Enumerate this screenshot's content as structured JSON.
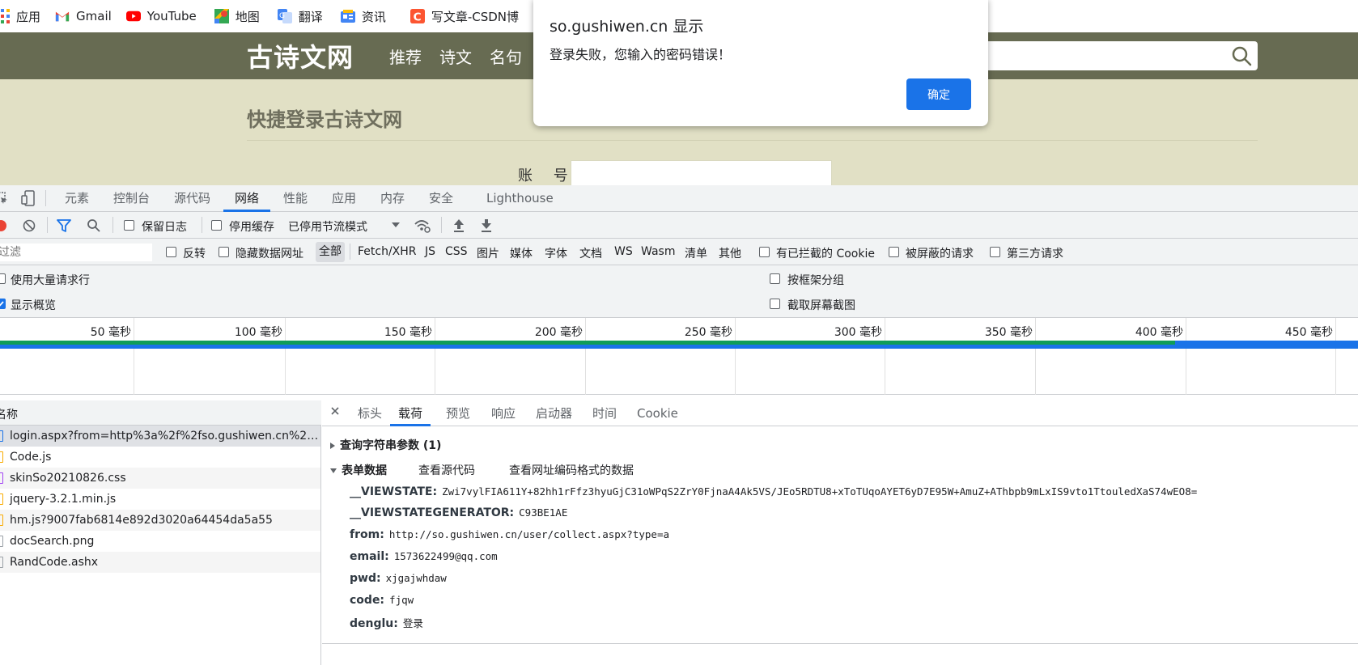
{
  "bookmarks": [
    {
      "label": "应用",
      "icon": "apps-grid-icon"
    },
    {
      "label": "Gmail",
      "icon": "gmail-icon"
    },
    {
      "label": "YouTube",
      "icon": "youtube-icon"
    },
    {
      "label": "地图",
      "icon": "maps-icon"
    },
    {
      "label": "翻译",
      "icon": "translate-icon"
    },
    {
      "label": "资讯",
      "icon": "news-icon"
    },
    {
      "label": "写文章-CSDN博",
      "icon": "csdn-icon"
    }
  ],
  "site": {
    "logo": "古诗文网",
    "nav": [
      "推荐",
      "诗文",
      "名句"
    ],
    "login_title": "快捷登录古诗文网",
    "account_label": "账 号"
  },
  "alert": {
    "origin": "so.gushiwen.cn 显示",
    "message": "登录失败，您输入的密码错误！",
    "ok_label": "确定"
  },
  "devtools": {
    "tabs": [
      "元素",
      "控制台",
      "源代码",
      "网络",
      "性能",
      "应用",
      "内存",
      "安全",
      "Lighthouse"
    ],
    "active_tab": "网络",
    "toolbar": {
      "preserve_log": "保留日志",
      "disable_cache": "停用缓存",
      "throttle": "已停用节流模式"
    },
    "filter": {
      "placeholder": "过滤",
      "invert": "反转",
      "hide_data_urls": "隐藏数据网址",
      "types": [
        "全部",
        "Fetch/XHR",
        "JS",
        "CSS",
        "图片",
        "媒体",
        "字体",
        "文档",
        "WS",
        "Wasm",
        "清单",
        "其他"
      ],
      "active_type": "全部",
      "blocked_cookies": "有已拦截的 Cookie",
      "blocked_requests": "被屏蔽的请求",
      "third_party": "第三方请求"
    },
    "settings": {
      "large_rows": "使用大量请求行",
      "group_by_frame": "按框架分组",
      "show_overview": "显示概览",
      "capture_screenshots": "截取屏幕截图"
    },
    "timeline_ticks": [
      "50 毫秒",
      "100 毫秒",
      "150 毫秒",
      "200 毫秒",
      "250 毫秒",
      "300 毫秒",
      "350 毫秒",
      "400 毫秒",
      "450 毫秒"
    ],
    "requests_header": "名称",
    "requests": [
      {
        "name": "login.aspx?from=http%3a%2f%2fso.gushiwen.cn%2fuse...",
        "color": "#1a73e8"
      },
      {
        "name": "Code.js",
        "color": "#f9ab00"
      },
      {
        "name": "skinSo20210826.css",
        "color": "#a142f4"
      },
      {
        "name": "jquery-3.2.1.min.js",
        "color": "#f9ab00"
      },
      {
        "name": "hm.js?9007fab6814e892d3020a64454da5a55",
        "color": "#f9ab00"
      },
      {
        "name": "docSearch.png",
        "color": "#9aa0a6"
      },
      {
        "name": "RandCode.ashx",
        "color": "#9aa0a6"
      }
    ],
    "detail_tabs": [
      "标头",
      "载荷",
      "预览",
      "响应",
      "启动器",
      "时间",
      "Cookie"
    ],
    "active_detail_tab": "载荷",
    "payload": {
      "query_section": "查询字符串参数 (1)",
      "form_section": "表单数据",
      "view_source": "查看源代码",
      "view_url_encoded": "查看网址编码格式的数据",
      "fields": [
        {
          "key": "__VIEWSTATE:",
          "value": "Zwi7vylFIA611Y+82hh1rFfz3hyuGjC31oWPqS2ZrY0FjnaA4Ak5VS/JEo5RDTU8+xToTUqoAYET6yD7E95W+AmuZ+AThbpb9mLxIS9vto1TtouledXaS74wEO8="
        },
        {
          "key": "__VIEWSTATEGENERATOR:",
          "value": "C93BE1AE"
        },
        {
          "key": "from:",
          "value": "http://so.gushiwen.cn/user/collect.aspx?type=a"
        },
        {
          "key": "email:",
          "value": "1573622499@qq.com"
        },
        {
          "key": "pwd:",
          "value": "xjgajwhdaw"
        },
        {
          "key": "code:",
          "value": "fjqw"
        },
        {
          "key": "denglu:",
          "value": "登录"
        }
      ]
    }
  }
}
